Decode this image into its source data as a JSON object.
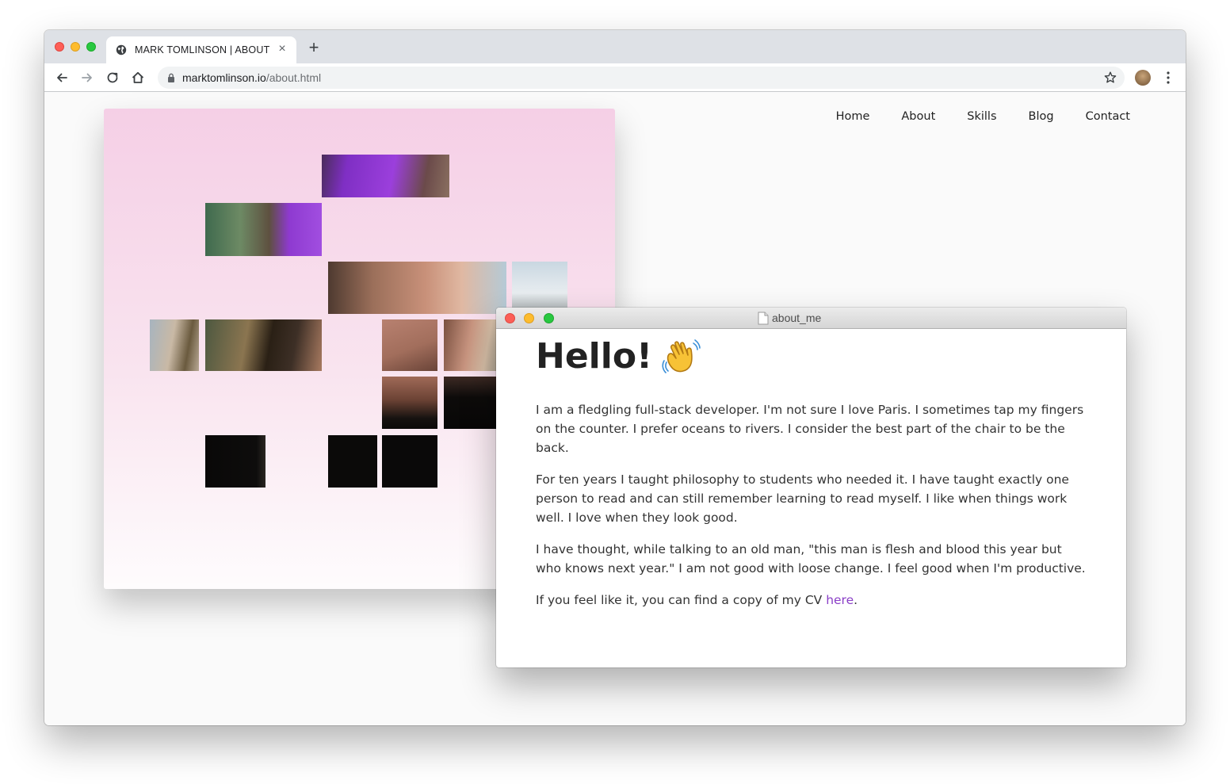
{
  "browser": {
    "tab_title": "MARK TOMLINSON | ABOUT",
    "tab_close_glyph": "×",
    "new_tab_glyph": "+",
    "url_host": "marktomlinson.io",
    "url_path": "/about.html",
    "icons": [
      "back-icon",
      "forward-icon",
      "reload-icon",
      "home-icon",
      "lock-icon",
      "star-icon",
      "avatar",
      "kebab-menu-icon"
    ]
  },
  "nav": {
    "items": [
      "Home",
      "About",
      "Skills",
      "Blog",
      "Contact"
    ]
  },
  "about_window": {
    "title": "about_me",
    "heading": "Hello!",
    "heading_emoji": "waving-hand-icon",
    "paragraphs": [
      "I am a fledgling full-stack developer. I'm not sure I love Paris. I sometimes tap my fingers on the counter. I prefer oceans to rivers. I consider the best part of the chair to be the back.",
      "For ten years I taught philosophy to students who needed it. I have taught exactly one person to read and can still remember learning to read myself. I like when things work well. I love when they look good.",
      "I have thought, while talking to an old man, \"this man is flesh and blood this year but who knows next year.\" I am not good with loose change. I feel good when I'm productive."
    ],
    "cv_text_before": "If you feel like it, you can find a copy of my CV ",
    "cv_link": "here",
    "cv_text_after": "."
  },
  "colors": {
    "link": "#8a3fc7",
    "card_gradient_top": "#f5cfe6",
    "card_gradient_bottom": "#fefcfd"
  }
}
